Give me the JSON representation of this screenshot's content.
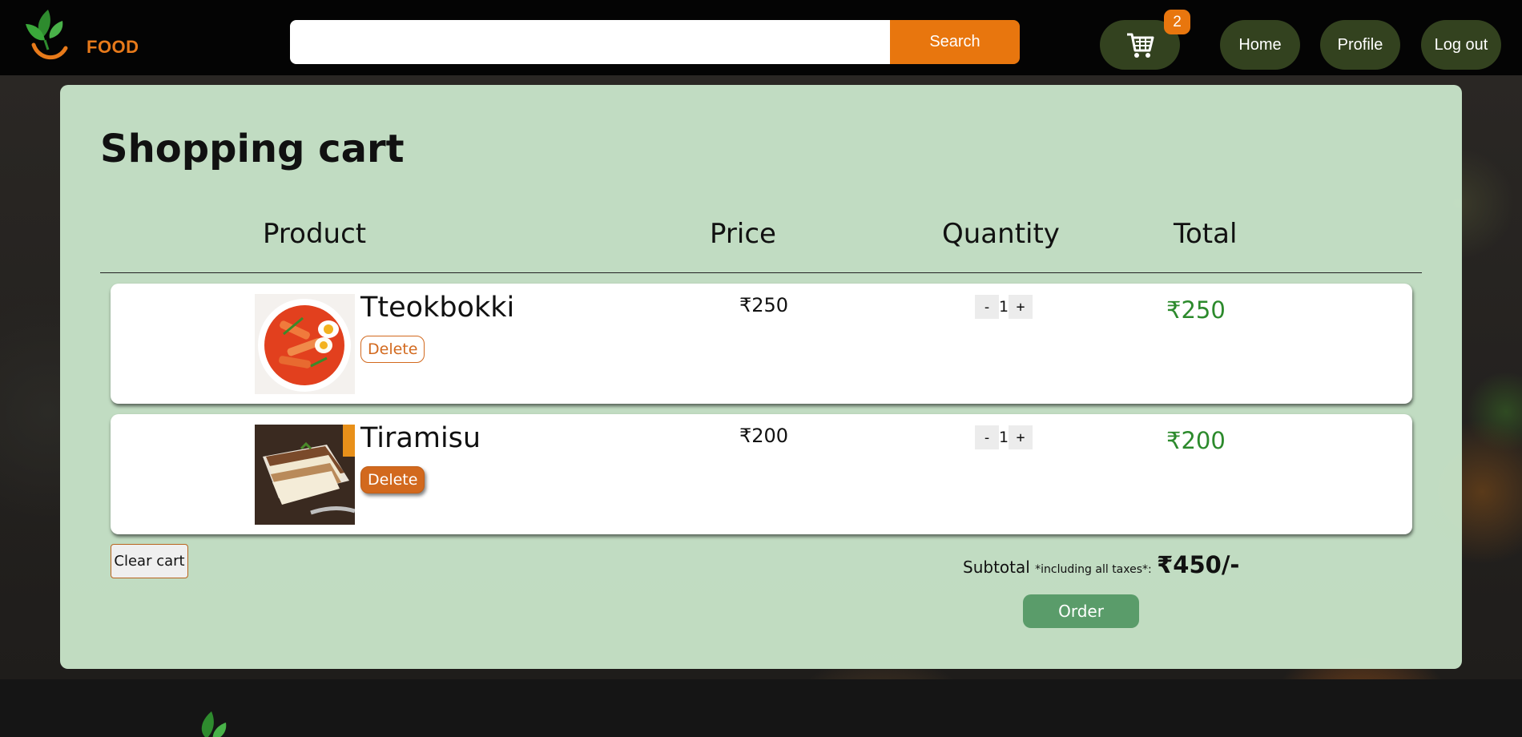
{
  "brand": {
    "logo_text": "FOOD"
  },
  "search": {
    "placeholder": "",
    "button_label": "Search"
  },
  "header": {
    "cart_count": "2",
    "nav": [
      {
        "label": "Home"
      },
      {
        "label": "Profile"
      },
      {
        "label": "Log out"
      }
    ]
  },
  "cart": {
    "title": "Shopping cart",
    "columns": {
      "product": "Product",
      "price": "Price",
      "quantity": "Quantity",
      "total": "Total"
    },
    "items": [
      {
        "name": "Tteokbokki",
        "delete_label": "Delete",
        "price": "₹250",
        "qty": "1",
        "total": "₹250",
        "image": "tteokbokki-photo"
      },
      {
        "name": "Tiramisu",
        "delete_label": "Delete",
        "price": "₹200",
        "qty": "1",
        "total": "₹200",
        "image": "tiramisu-photo"
      }
    ],
    "qty_minus": "-",
    "qty_plus": "+",
    "clear_label": "Clear cart",
    "subtotal_label": "Subtotal",
    "subtotal_note": "*including all taxes*:",
    "subtotal_amount": "₹450/-",
    "order_label": "Order"
  },
  "colors": {
    "accent": "#e8760e",
    "nav_pill": "#33421f",
    "panel": "#c6e2c7",
    "total_text": "#2c8a2c",
    "order_button": "#5a9c6a"
  }
}
